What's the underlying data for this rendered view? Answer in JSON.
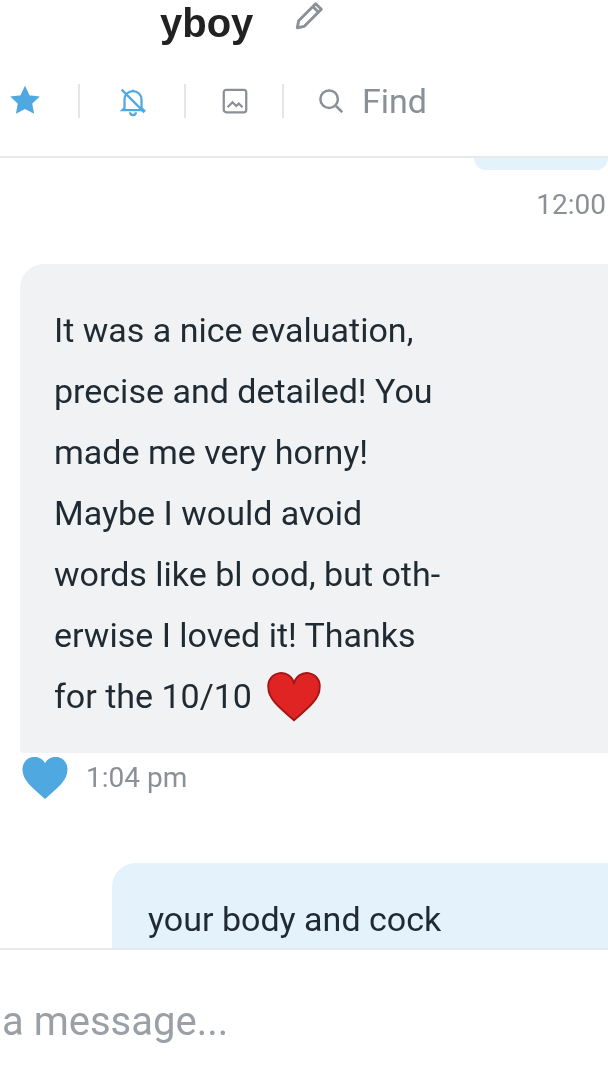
{
  "header": {
    "title": "yboy"
  },
  "toolbar": {
    "starred": true,
    "muted": true,
    "find_label": "Find"
  },
  "messages": [
    {
      "kind": "tail",
      "time": "12:00"
    },
    {
      "kind": "incoming",
      "lines": [
        "It was a nice evaluation,",
        "precise and detailed! You",
        "made me very horny!",
        "Maybe I would avoid",
        "words like bl ood, but oth-",
        "erwise I loved it! Thanks",
        "for the 10/10"
      ],
      "emoji_heart": true,
      "liked": true,
      "time": "1:04 pm"
    },
    {
      "kind": "outgoing",
      "lines": [
        "your body and cock"
      ]
    }
  ],
  "composer": {
    "placeholder": "a message..."
  }
}
